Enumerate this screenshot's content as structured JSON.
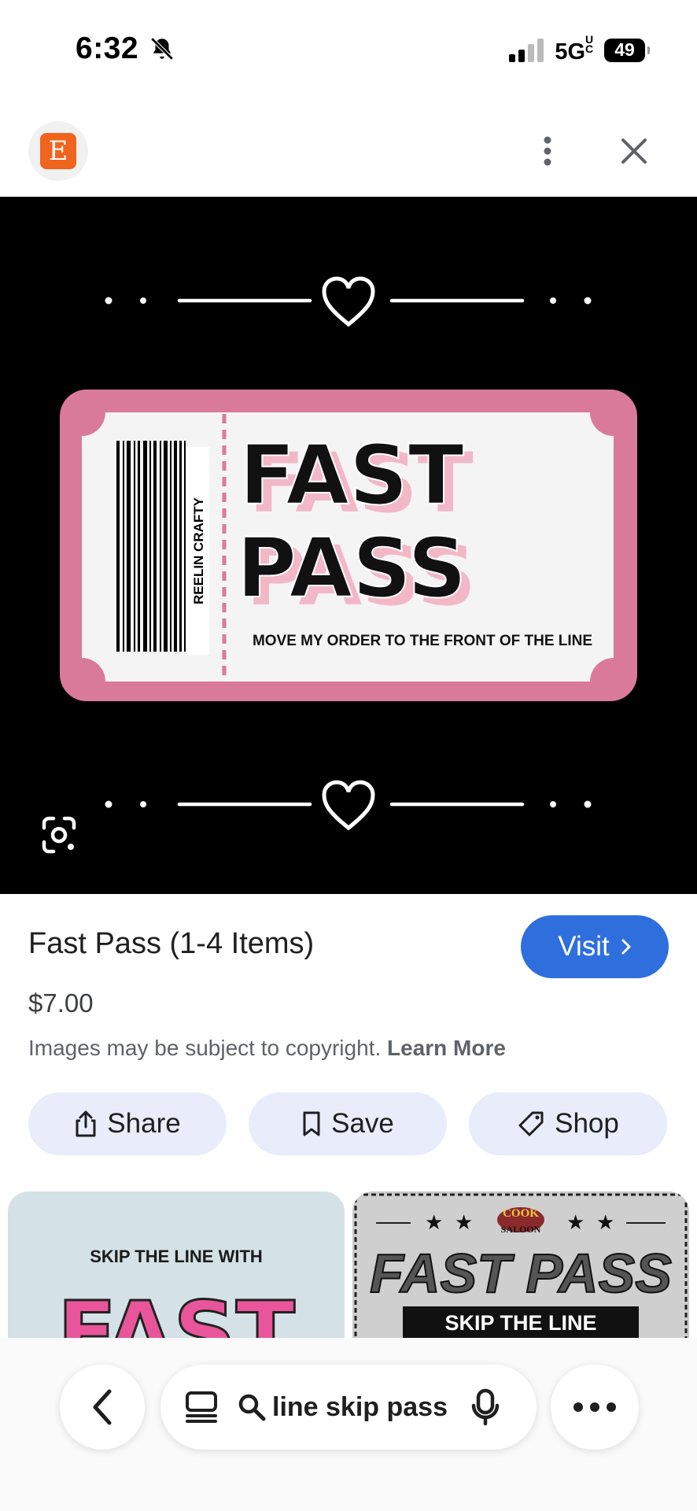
{
  "status_bar": {
    "time": "6:32",
    "network": "5G",
    "network_suffix": "UC",
    "battery": "49"
  },
  "header": {
    "site_initial": "E"
  },
  "hero": {
    "brand_text": "REELIN CRAFTY",
    "ticket_line1": "FAST",
    "ticket_line2": "PASS",
    "ticket_caption": "MOVE MY ORDER TO THE FRONT OF THE LINE",
    "ticket_color": "#d97a9a"
  },
  "product": {
    "title": "Fast Pass (1-4 Items)",
    "price": "$7.00",
    "visit_label": "Visit",
    "copyright_text": "Images may be subject to copyright.",
    "learn_more": "Learn More"
  },
  "actions": [
    {
      "label": "Share",
      "icon": "share-icon"
    },
    {
      "label": "Save",
      "icon": "bookmark-icon"
    },
    {
      "label": "Shop",
      "icon": "tag-icon"
    }
  ],
  "related": [
    {
      "line1": "SKIP THE LINE WITH",
      "line2": "FAST"
    },
    {
      "badge_top": "COOK",
      "badge_bottom": "SALOON",
      "title": "FAST PASS",
      "subtitle": "SKIP THE LINE"
    }
  ],
  "search": {
    "query": "line skip pass"
  },
  "colors": {
    "accent": "#2f6fdd",
    "chip_bg": "#e8ecfb",
    "hero_bg": "#000000"
  }
}
